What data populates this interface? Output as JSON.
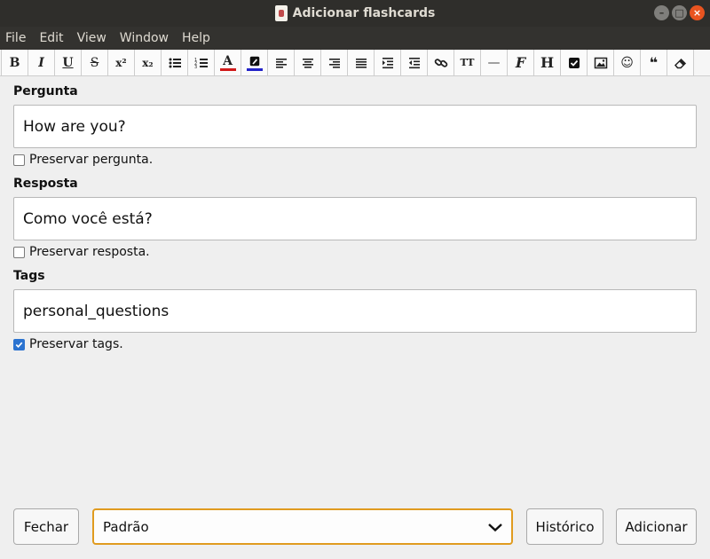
{
  "window": {
    "title": "Adicionar flashcards",
    "controls": [
      "minimize-icon",
      "maximize-icon",
      "close-icon"
    ]
  },
  "menu": {
    "items": [
      "File",
      "Edit",
      "View",
      "Window",
      "Help"
    ]
  },
  "toolbar": {
    "buttons": [
      {
        "name": "bold-button",
        "glyph": "B"
      },
      {
        "name": "italic-button",
        "glyph": "I"
      },
      {
        "name": "underline-button",
        "glyph": "U"
      },
      {
        "name": "strikethrough-button",
        "glyph": "S"
      },
      {
        "name": "superscript-button",
        "glyph": "x²"
      },
      {
        "name": "subscript-button",
        "glyph": "x₂"
      },
      {
        "name": "bullet-list-button",
        "icon": "bullet-list-icon"
      },
      {
        "name": "numbered-list-button",
        "icon": "numbered-list-icon"
      },
      {
        "name": "text-color-button",
        "glyph": "A",
        "color": "#d11a1a"
      },
      {
        "name": "highlight-button",
        "icon": "highlighter-icon",
        "color": "#2323c8"
      },
      {
        "name": "align-left-button",
        "icon": "align-left-icon"
      },
      {
        "name": "align-center-button",
        "icon": "align-center-icon"
      },
      {
        "name": "align-right-button",
        "icon": "align-right-icon"
      },
      {
        "name": "align-justify-button",
        "icon": "align-justify-icon"
      },
      {
        "name": "indent-button",
        "icon": "indent-icon"
      },
      {
        "name": "outdent-button",
        "icon": "outdent-icon"
      },
      {
        "name": "link-button",
        "icon": "link-icon"
      },
      {
        "name": "font-size-button",
        "glyph": "TT"
      },
      {
        "name": "horizontal-rule-button",
        "glyph": "—"
      },
      {
        "name": "function-button",
        "glyph": "F"
      },
      {
        "name": "heading-button",
        "glyph": "H"
      },
      {
        "name": "checkbox-button",
        "icon": "checkbox-icon"
      },
      {
        "name": "image-button",
        "icon": "image-icon"
      },
      {
        "name": "emoji-button",
        "glyph": "☺"
      },
      {
        "name": "quote-button",
        "glyph": "❝"
      },
      {
        "name": "eraser-button",
        "icon": "eraser-icon"
      }
    ]
  },
  "fields": {
    "question": {
      "label": "Pergunta",
      "value": "How are you?",
      "preserve_label": "Preservar pergunta.",
      "preserve_checked": false
    },
    "answer": {
      "label": "Resposta",
      "value": "Como você está?",
      "preserve_label": "Preservar resposta.",
      "preserve_checked": false
    },
    "tags": {
      "label": "Tags",
      "value": "personal_questions",
      "preserve_label": "Preservar tags.",
      "preserve_checked": true
    }
  },
  "footer": {
    "close_label": "Fechar",
    "deck_selected": "Padrão",
    "history_label": "Histórico",
    "add_label": "Adicionar"
  },
  "colors": {
    "titlebar": "#2f2e2b",
    "close_button": "#e95420",
    "select_focus": "#e09b1f",
    "checkbox_checked": "#2b73d0"
  }
}
